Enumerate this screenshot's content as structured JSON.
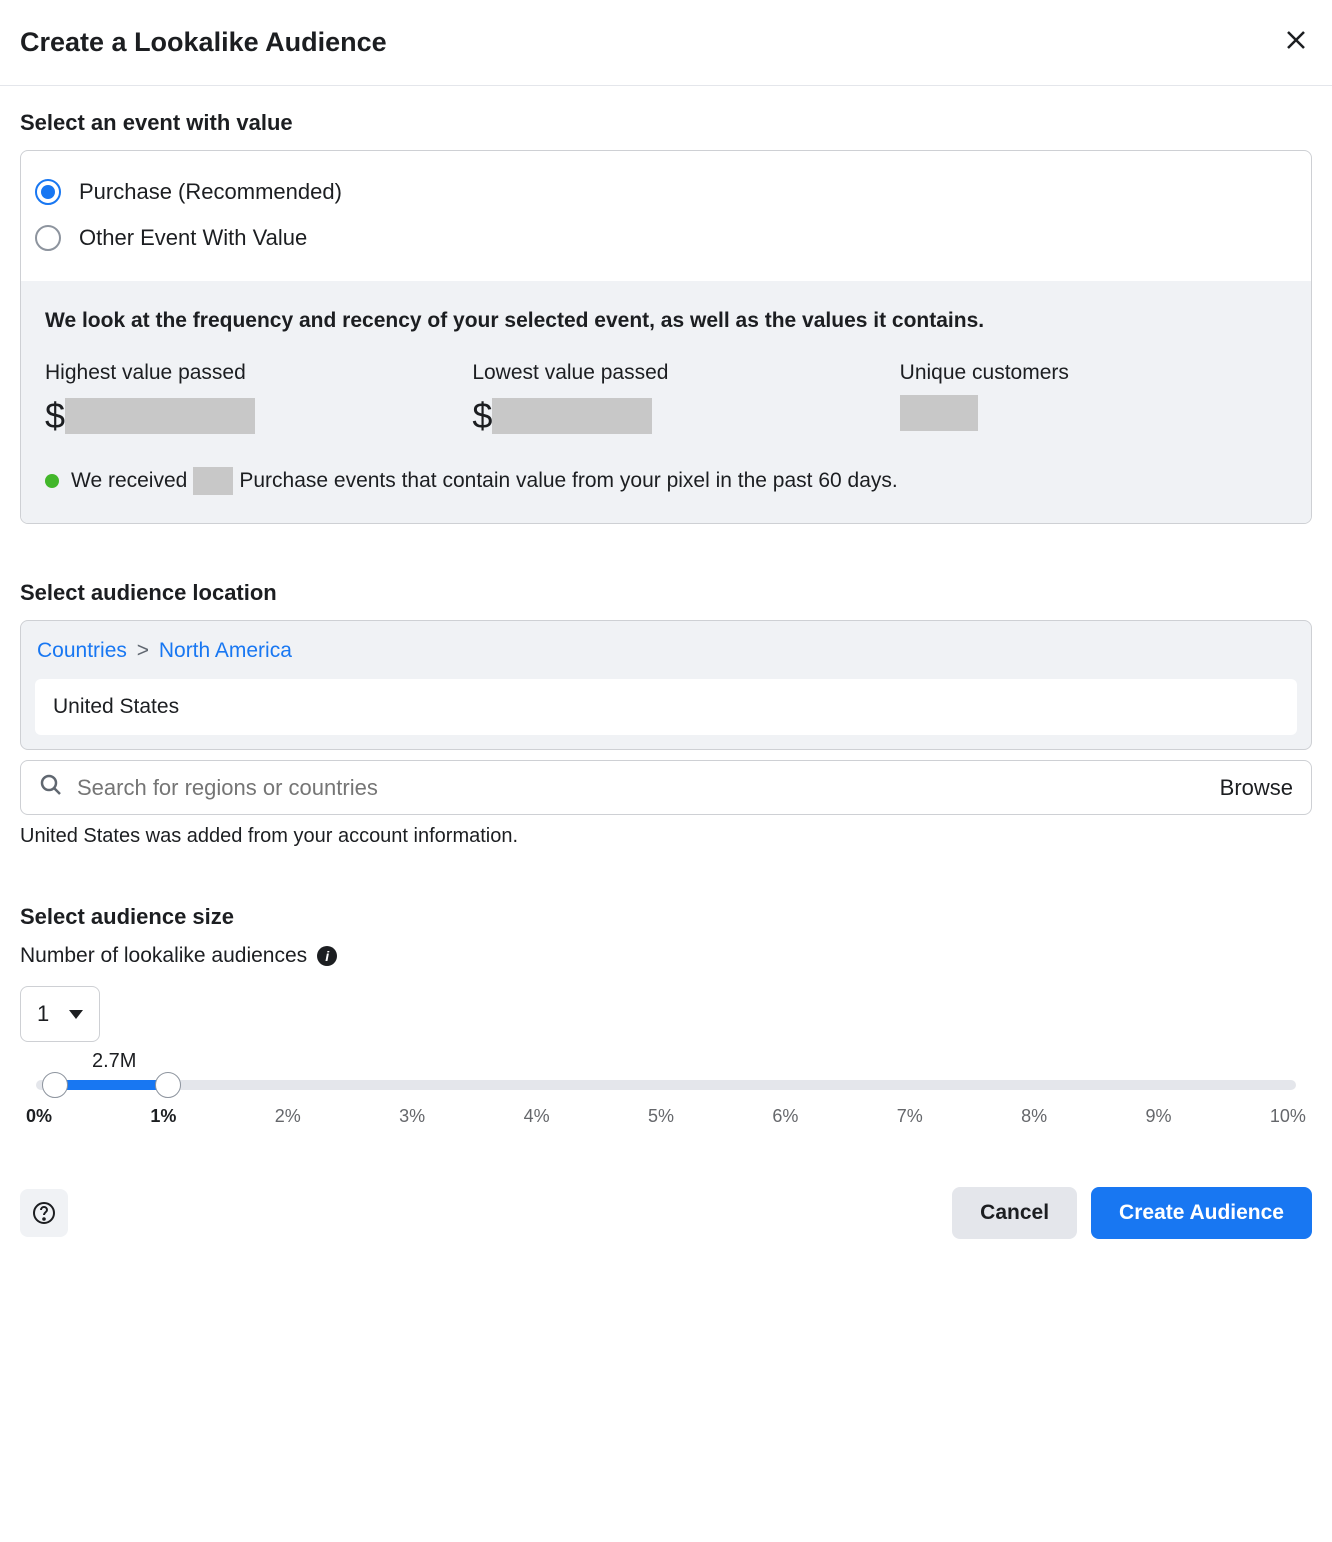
{
  "header": {
    "title": "Create a Lookalike Audience"
  },
  "eventSection": {
    "label": "Select an event with value",
    "options": [
      {
        "label": "Purchase (Recommended)",
        "selected": true
      },
      {
        "label": "Other Event With Value",
        "selected": false
      }
    ],
    "stats": {
      "intro": "We look at the frequency and recency of your selected event, as well as the values it contains.",
      "highestLabel": "Highest value passed",
      "highestPrefix": "$",
      "lowestLabel": "Lowest value passed",
      "lowestPrefix": "$",
      "uniqueLabel": "Unique customers",
      "statusPrefix": "We received",
      "statusSuffix": "Purchase events that contain value from your pixel in the past 60 days."
    }
  },
  "locationSection": {
    "label": "Select audience location",
    "breadcrumb": {
      "root": "Countries",
      "region": "North America"
    },
    "selected": "United States",
    "searchPlaceholder": "Search for regions or countries",
    "browseLabel": "Browse",
    "helper": "United States was added from your account information."
  },
  "sizeSection": {
    "label": "Select audience size",
    "sublabel": "Number of lookalike audiences",
    "countValue": "1",
    "sliderCallout": "2.7M",
    "ticks": [
      "0%",
      "1%",
      "2%",
      "3%",
      "4%",
      "5%",
      "6%",
      "7%",
      "8%",
      "9%",
      "10%"
    ]
  },
  "footer": {
    "cancel": "Cancel",
    "create": "Create Audience"
  }
}
